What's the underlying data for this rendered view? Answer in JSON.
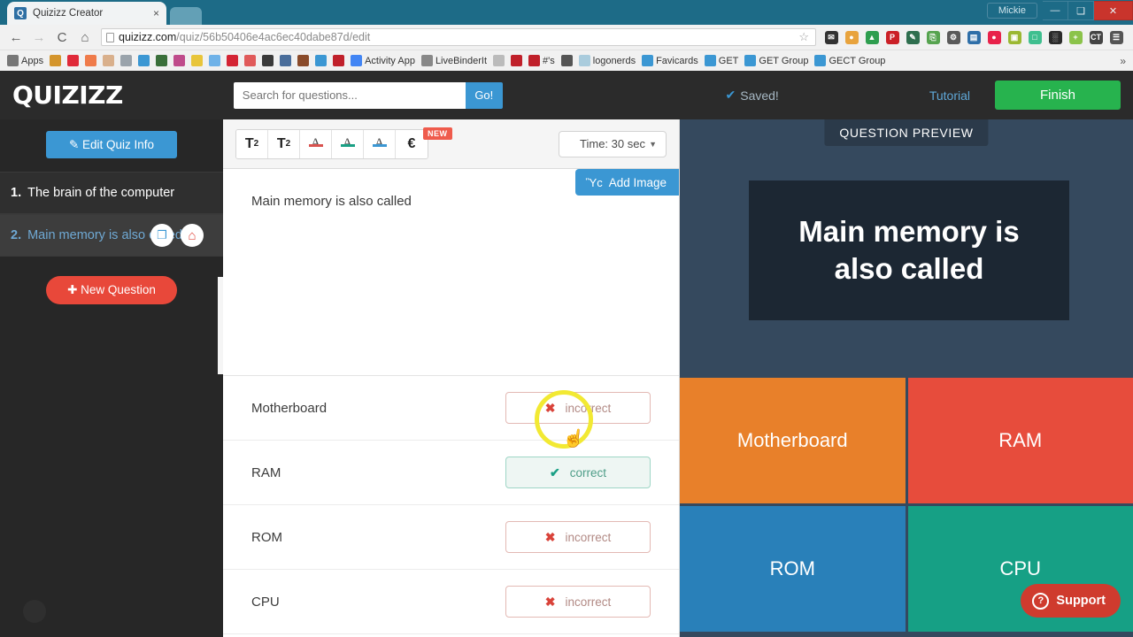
{
  "browser": {
    "tab": {
      "title": "Quizizz Creator",
      "favicon": "Q",
      "close_label": "×"
    },
    "profile": "Mickie",
    "window_buttons": {
      "minimize": "—",
      "maximize": "❑",
      "close": "✕"
    },
    "nav": {
      "back": "←",
      "forward": "→",
      "reload": "C",
      "home": "⌂"
    },
    "url_prefix": "quizizz.com",
    "url_suffix": "/quiz/56b50406e4ac6ec40dabe87d/edit",
    "star": "☆",
    "extensions": [
      {
        "name": "dnd-mail-icon",
        "glyph": "✉",
        "color": "#333333"
      },
      {
        "name": "monkey-icon",
        "glyph": "●",
        "color": "#e8a33d"
      },
      {
        "name": "google-drive-icon",
        "glyph": "▲",
        "color": "#2e9e4f"
      },
      {
        "name": "pinterest-icon",
        "glyph": "P",
        "color": "#cb2027"
      },
      {
        "name": "eyedropper-icon",
        "glyph": "✎",
        "color": "#2f6f4f"
      },
      {
        "name": "screencast-icon",
        "glyph": "⎘",
        "color": "#56a34f"
      },
      {
        "name": "lamp-icon",
        "glyph": "⚙",
        "color": "#5a5a5a"
      },
      {
        "name": "book-icon",
        "glyph": "▤",
        "color": "#2f6fa8"
      },
      {
        "name": "record-icon",
        "glyph": "●",
        "color": "#e8224a"
      },
      {
        "name": "contacts-icon",
        "glyph": "▣",
        "color": "#9bb832"
      },
      {
        "name": "chat-icon",
        "glyph": "□",
        "color": "#3fbf8f"
      },
      {
        "name": "film-icon",
        "glyph": "░",
        "color": "#2a2a2a"
      },
      {
        "name": "plus-circle-icon",
        "glyph": "+",
        "color": "#8bc34a"
      },
      {
        "name": "ct-icon",
        "glyph": "CT",
        "color": "#444444"
      },
      {
        "name": "menu-icon",
        "glyph": "☰",
        "color": "#555555"
      }
    ],
    "bookmarks": [
      {
        "label": "Apps",
        "icon": "grid",
        "color": "#777777"
      },
      {
        "label": "",
        "icon": "popcorn",
        "color": "#d4952c"
      },
      {
        "label": "",
        "icon": "heart",
        "color": "#e02a39"
      },
      {
        "label": "",
        "icon": "flower",
        "color": "#ef7b4a"
      },
      {
        "label": "",
        "icon": "package",
        "color": "#d9b08c"
      },
      {
        "label": "",
        "icon": "phone",
        "color": "#9aa3ab"
      },
      {
        "label": "",
        "icon": "bird",
        "color": "#3b97d3"
      },
      {
        "label": "",
        "icon": "tree",
        "color": "#3a6f3a"
      },
      {
        "label": "",
        "icon": "clown",
        "color": "#bf4b8b"
      },
      {
        "label": "",
        "icon": "emoji",
        "color": "#e8c53a"
      },
      {
        "label": "",
        "icon": "snowflake",
        "color": "#6fb2e8"
      },
      {
        "label": "",
        "icon": "star",
        "color": "#d42434"
      },
      {
        "label": "",
        "icon": "gift",
        "color": "#e05a5a"
      },
      {
        "label": "",
        "icon": "ring",
        "color": "#3a3a3a"
      },
      {
        "label": "",
        "icon": "laptop",
        "color": "#4a6e9b"
      },
      {
        "label": "",
        "icon": "cocoa",
        "color": "#8a4b2a"
      },
      {
        "label": "",
        "icon": "twitter",
        "color": "#3b97d3"
      },
      {
        "label": "",
        "icon": "flag",
        "color": "#c0202a"
      },
      {
        "label": "Activity App",
        "icon": "google",
        "color": "#4285f4"
      },
      {
        "label": "LiveBinderIt",
        "icon": "page",
        "color": "#888888"
      },
      {
        "label": "",
        "icon": "phone2",
        "color": "#bbbbbb"
      },
      {
        "label": "",
        "icon": "anchor",
        "color": "#c0202a"
      },
      {
        "label": "#'s",
        "icon": "balloon",
        "color": "#c0202a"
      },
      {
        "label": "",
        "icon": "download",
        "color": "#555555"
      },
      {
        "label": "logonerds",
        "icon": "circle",
        "color": "#aaccdd"
      },
      {
        "label": "Favicards",
        "icon": "asterisk",
        "color": "#3b97d3"
      },
      {
        "label": "GET",
        "icon": "window",
        "color": "#3b97d3"
      },
      {
        "label": "GET Group",
        "icon": "book2",
        "color": "#3b97d3"
      },
      {
        "label": "GECT Group",
        "icon": "book2",
        "color": "#3b97d3"
      }
    ],
    "bookmarks_overflow": "»"
  },
  "app": {
    "logo": "QUIZIZZ",
    "search": {
      "value": "",
      "placeholder": "Search for questions...",
      "go_label": "Go!"
    },
    "saved_label": "Saved!",
    "saved_check": "✔",
    "tutorial_label": "Tutorial",
    "finish_label": "Finish"
  },
  "sidebar": {
    "edit_quiz_label": "Edit Quiz Info",
    "edit_quiz_icon": "✎",
    "questions": [
      {
        "num": "1.",
        "title": "The brain of the computer",
        "active": false
      },
      {
        "num": "2.",
        "title": "Main memory is also called",
        "active": true
      }
    ],
    "row_actions": {
      "duplicate_icon": "❐",
      "delete_icon": "Ὕ1"
    },
    "new_question_label": "New Question",
    "new_question_icon": "✚"
  },
  "editor": {
    "toolbar": {
      "superscript": "T",
      "superscript_sup": "2",
      "subscript": "T",
      "subscript_sub": "2",
      "color_red": "A",
      "color_green": "A",
      "color_blue": "A",
      "currency": "€",
      "new_badge": "NEW",
      "time_label": "Time: 30 sec",
      "time_caret": "▼"
    },
    "question_text": "Main memory is also called",
    "add_image_label": "Add Image",
    "add_image_icon": "Ὓc",
    "answers": [
      {
        "text": "Motherboard",
        "state_label": "incorrect",
        "state": "incorrect",
        "mark": "✖"
      },
      {
        "text": "RAM",
        "state_label": "correct",
        "state": "correct",
        "mark": "✔"
      },
      {
        "text": "ROM",
        "state_label": "incorrect",
        "state": "incorrect",
        "mark": "✖"
      },
      {
        "text": "CPU",
        "state_label": "incorrect",
        "state": "incorrect",
        "mark": "✖"
      }
    ],
    "cursor_glyph": "☝"
  },
  "preview": {
    "badge": "QUESTION PREVIEW",
    "question": "Main memory is also called",
    "tiles": [
      {
        "label": "Motherboard",
        "color": "#e8802a"
      },
      {
        "label": "RAM",
        "color": "#e74c3c"
      },
      {
        "label": "ROM",
        "color": "#2980b9"
      },
      {
        "label": "CPU",
        "color": "#16a085"
      }
    ],
    "support_label": "Support",
    "support_icon": "?"
  },
  "colors": {
    "brand_blue": "#3b97d3",
    "finish_green": "#27b34e",
    "new_question_red": "#e8483a",
    "preview_bg": "#35495e",
    "card_bg": "#1c2733",
    "support_red": "#cf3b2e",
    "highlight_yellow": "#f2e933"
  }
}
